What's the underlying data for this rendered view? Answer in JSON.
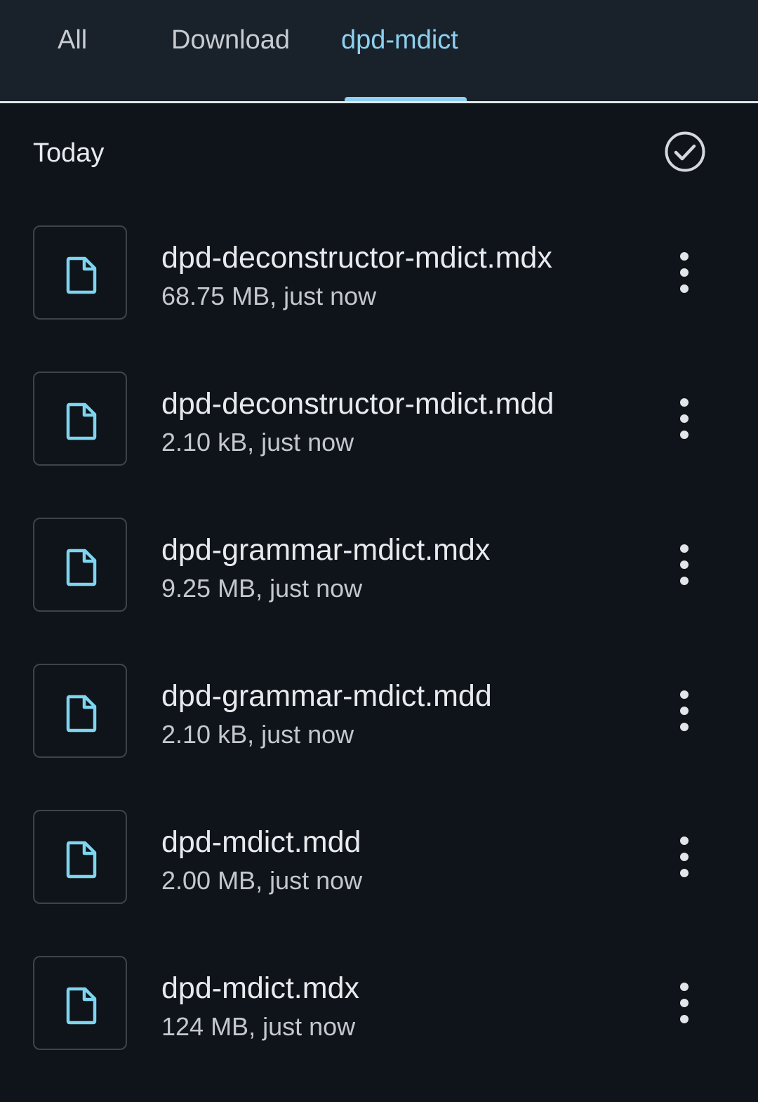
{
  "tabs": [
    {
      "label": "All",
      "active": false
    },
    {
      "label": "Download",
      "active": false
    },
    {
      "label": "dpd-mdict",
      "active": true
    }
  ],
  "section": {
    "title": "Today"
  },
  "files": [
    {
      "name": "dpd-deconstructor-mdict.mdx",
      "meta": "68.75 MB, just now"
    },
    {
      "name": "dpd-deconstructor-mdict.mdd",
      "meta": "2.10 kB, just now"
    },
    {
      "name": "dpd-grammar-mdict.mdx",
      "meta": "9.25 MB, just now"
    },
    {
      "name": "dpd-grammar-mdict.mdd",
      "meta": "2.10 kB, just now"
    },
    {
      "name": "dpd-mdict.mdd",
      "meta": "2.00 MB, just now"
    },
    {
      "name": "dpd-mdict.mdx",
      "meta": "124 MB, just now"
    }
  ],
  "icons": {
    "select_all": "check-circle-icon",
    "file": "file-icon",
    "more": "more-vert-icon"
  },
  "colors": {
    "background": "#0f141b",
    "tabbar": "#19222b",
    "accent": "#8dd0f0",
    "file_icon": "#7fd4ee",
    "text_primary": "#e8eaed",
    "text_secondary": "#c4c8cc"
  }
}
